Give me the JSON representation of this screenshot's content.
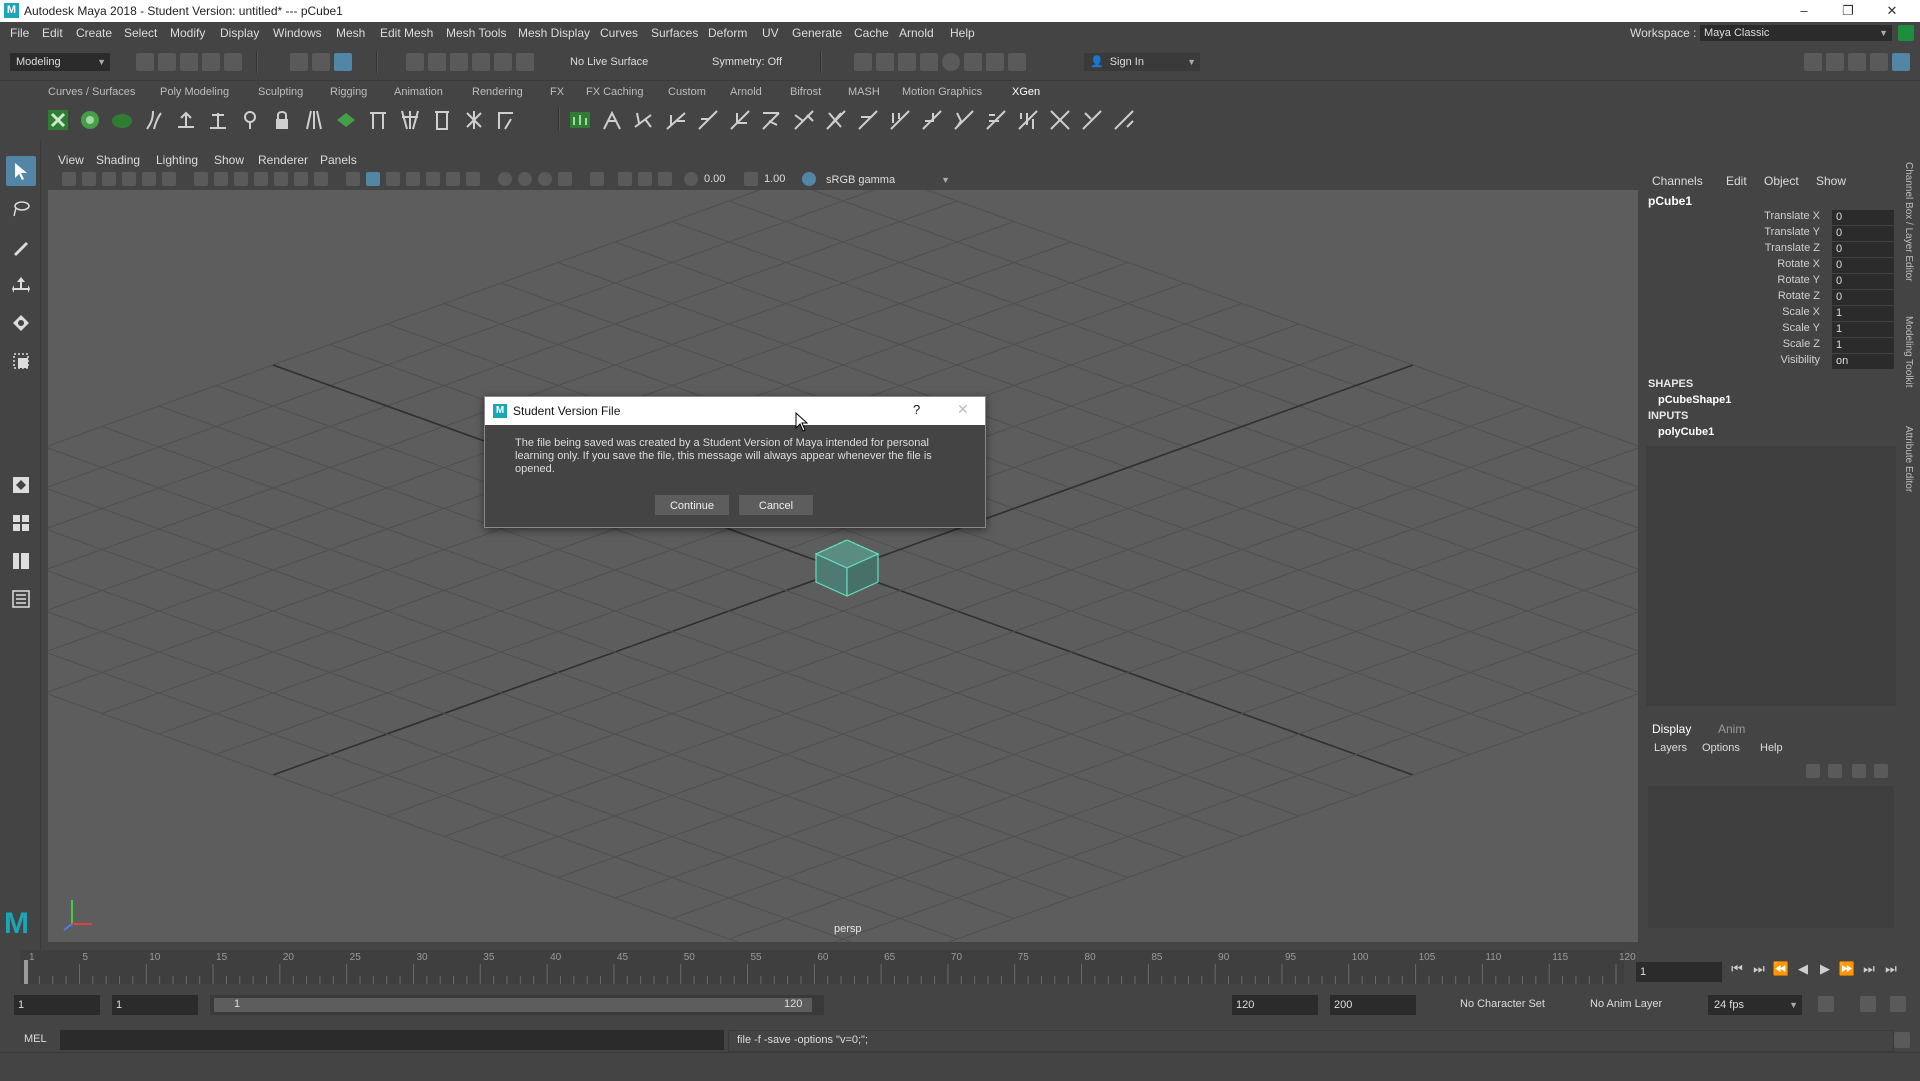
{
  "window": {
    "title": "Autodesk Maya 2018 - Student Version: untitled*  ---  pCube1",
    "logo_letter": "M",
    "minimize_glyph": "–",
    "maximize_glyph": "❐",
    "close_glyph": "✕"
  },
  "menubar": {
    "items": [
      "File",
      "Edit",
      "Create",
      "Select",
      "Modify",
      "Display",
      "Windows",
      "Mesh",
      "Edit Mesh",
      "Mesh Tools",
      "Mesh Display",
      "Curves",
      "Surfaces",
      "Deform",
      "UV",
      "Generate",
      "Cache",
      "Arnold",
      "Help"
    ],
    "workspace_label": "Workspace :",
    "workspace_value": "Maya Classic"
  },
  "statusline": {
    "mode": "Modeling",
    "live_surface": "No Live Surface",
    "symmetry": "Symmetry: Off",
    "sign_in": "Sign In"
  },
  "shelf": {
    "tabs": [
      "Curves / Surfaces",
      "Poly Modeling",
      "Sculpting",
      "Rigging",
      "Animation",
      "Rendering",
      "FX",
      "FX Caching",
      "Custom",
      "Arnold",
      "Bifrost",
      "MASH",
      "Motion Graphics",
      "XGen"
    ],
    "active_tab": "XGen"
  },
  "viewport": {
    "menu": [
      "View",
      "Shading",
      "Lighting",
      "Show",
      "Renderer",
      "Panels"
    ],
    "exposure": "0.00",
    "gamma": "1.00",
    "color_space": "sRGB gamma",
    "camera_label": "persp"
  },
  "dialog": {
    "title": "Student Version File",
    "help_glyph": "?",
    "close_glyph": "✕",
    "message": "The file being saved was created by a Student Version of Maya intended for personal learning only. If you save the file, this message will always appear whenever the file is opened.",
    "continue_label": "Continue",
    "cancel_label": "Cancel"
  },
  "channelbox": {
    "menu": [
      "Channels",
      "Edit",
      "Object",
      "Show"
    ],
    "object": "pCube1",
    "attributes": [
      {
        "label": "Translate X",
        "value": "0"
      },
      {
        "label": "Translate Y",
        "value": "0"
      },
      {
        "label": "Translate Z",
        "value": "0"
      },
      {
        "label": "Rotate X",
        "value": "0"
      },
      {
        "label": "Rotate Y",
        "value": "0"
      },
      {
        "label": "Rotate Z",
        "value": "0"
      },
      {
        "label": "Scale X",
        "value": "1"
      },
      {
        "label": "Scale Y",
        "value": "1"
      },
      {
        "label": "Scale Z",
        "value": "1"
      },
      {
        "label": "Visibility",
        "value": "on"
      }
    ],
    "shapes_header": "SHAPES",
    "shape_item": "pCubeShape1",
    "inputs_header": "INPUTS",
    "input_item": "polyCube1"
  },
  "layer_editor": {
    "tabs": [
      "Display",
      "Anim"
    ],
    "menu": [
      "Layers",
      "Options",
      "Help"
    ]
  },
  "side_tabs": [
    "Channel Box / Layer Editor",
    "Modeling Toolkit",
    "Attribute Editor"
  ],
  "timeline": {
    "ticks": [
      "1",
      "5",
      "10",
      "15",
      "20",
      "25",
      "30",
      "35",
      "40",
      "45",
      "50",
      "55",
      "60",
      "65",
      "70",
      "75",
      "80",
      "85",
      "90",
      "95",
      "100",
      "105",
      "110",
      "115",
      "120"
    ],
    "current_frame": "1"
  },
  "range": {
    "start": "1",
    "playback_start": "1",
    "slider_start": "1",
    "slider_end": "120",
    "playback_end": "120",
    "end": "200",
    "character_set": "No Character Set",
    "anim_layer": "No Anim Layer",
    "fps": "24 fps"
  },
  "command": {
    "language": "MEL",
    "output": "file -f -save  -options \"v=0;\";"
  },
  "colors": {
    "accent": "#5285a6",
    "maya_teal": "#1aa6b7",
    "cube_wire": "#5fe0c0"
  }
}
